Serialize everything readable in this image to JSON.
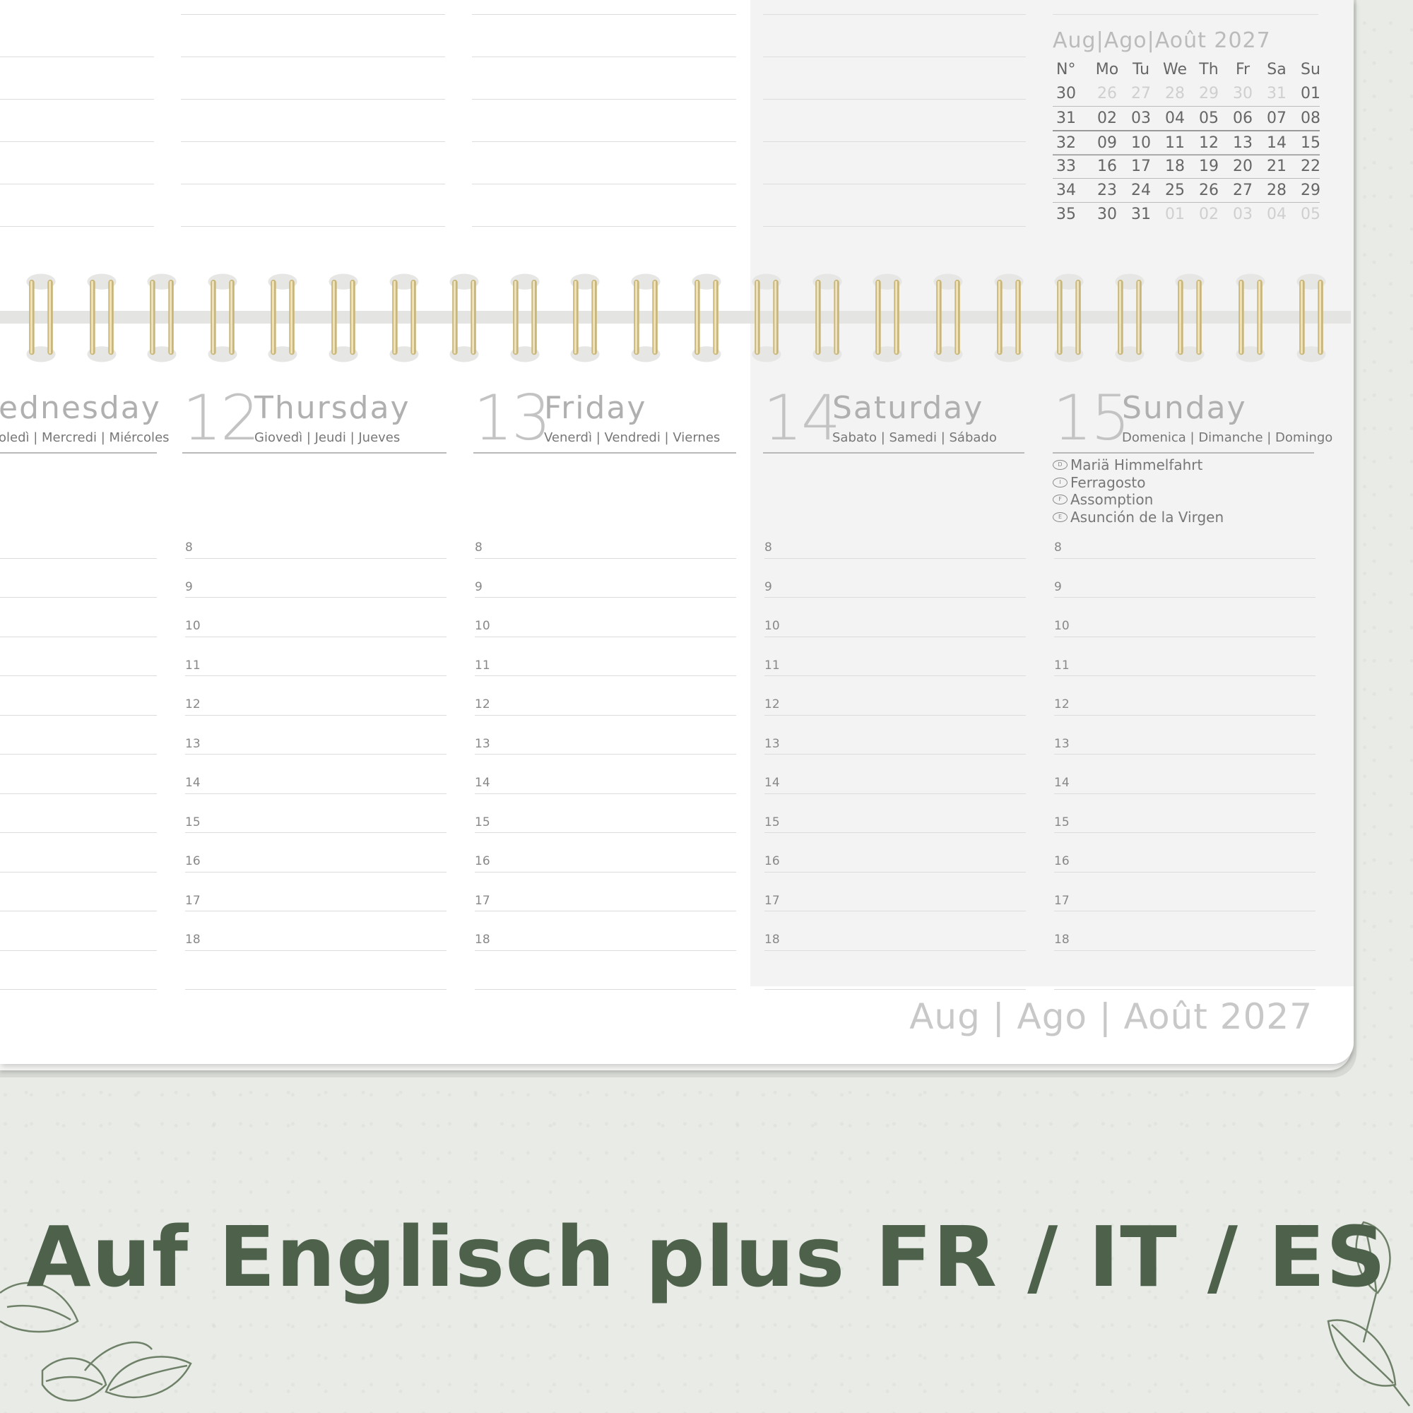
{
  "mini_calendar": {
    "title": "Aug|Ago|Août 2027",
    "headers": [
      "N°",
      "Mo",
      "Tu",
      "We",
      "Th",
      "Fr",
      "Sa",
      "Su"
    ],
    "weeks": [
      {
        "wk": "30",
        "days": [
          "26",
          "27",
          "28",
          "29",
          "30",
          "31",
          "01"
        ],
        "dim": [
          true,
          true,
          true,
          true,
          true,
          true,
          false
        ]
      },
      {
        "wk": "31",
        "days": [
          "02",
          "03",
          "04",
          "05",
          "06",
          "07",
          "08"
        ],
        "dim": [
          false,
          false,
          false,
          false,
          false,
          false,
          false
        ]
      },
      {
        "wk": "32",
        "days": [
          "09",
          "10",
          "11",
          "12",
          "13",
          "14",
          "15"
        ],
        "dim": [
          false,
          false,
          false,
          false,
          false,
          false,
          false
        ]
      },
      {
        "wk": "33",
        "days": [
          "16",
          "17",
          "18",
          "19",
          "20",
          "21",
          "22"
        ],
        "dim": [
          false,
          false,
          false,
          false,
          false,
          false,
          false
        ]
      },
      {
        "wk": "34",
        "days": [
          "23",
          "24",
          "25",
          "26",
          "27",
          "28",
          "29"
        ],
        "dim": [
          false,
          false,
          false,
          false,
          false,
          false,
          false
        ]
      },
      {
        "wk": "35",
        "days": [
          "30",
          "31",
          "01",
          "02",
          "03",
          "04",
          "05"
        ],
        "dim": [
          false,
          false,
          true,
          true,
          true,
          true,
          true
        ]
      }
    ],
    "current_week": "32"
  },
  "days": [
    {
      "num": "",
      "name": "ednesday",
      "sub": "oledì | Mercredi | Miércoles"
    },
    {
      "num": "12",
      "name": "Thursday",
      "sub": "Giovedì | Jeudi | Jueves"
    },
    {
      "num": "13",
      "name": "Friday",
      "sub": "Venerdì | Vendredi | Viernes"
    },
    {
      "num": "14",
      "name": "Saturday",
      "sub": "Sabato | Samedi | Sábado"
    },
    {
      "num": "15",
      "name": "Sunday",
      "sub": "Domenica | Dimanche | Domingo"
    }
  ],
  "hours": [
    "8",
    "9",
    "10",
    "11",
    "12",
    "13",
    "14",
    "15",
    "16",
    "17",
    "18"
  ],
  "holidays": [
    {
      "icon": "D",
      "label": "Mariä Himmelfahrt"
    },
    {
      "icon": "I",
      "label": "Ferragosto"
    },
    {
      "icon": "F",
      "label": "Assomption"
    },
    {
      "icon": "E",
      "label": "Asunción de la Virgen"
    }
  ],
  "footer_month": "Aug | Ago | Août 2027",
  "slogan": "Auf Englisch plus FR / IT / ES",
  "colors": {
    "slogan": "#4e624b",
    "spiral": "#c9b67a",
    "weekend": "#f3f3f3",
    "background": "#e8ebe6"
  }
}
